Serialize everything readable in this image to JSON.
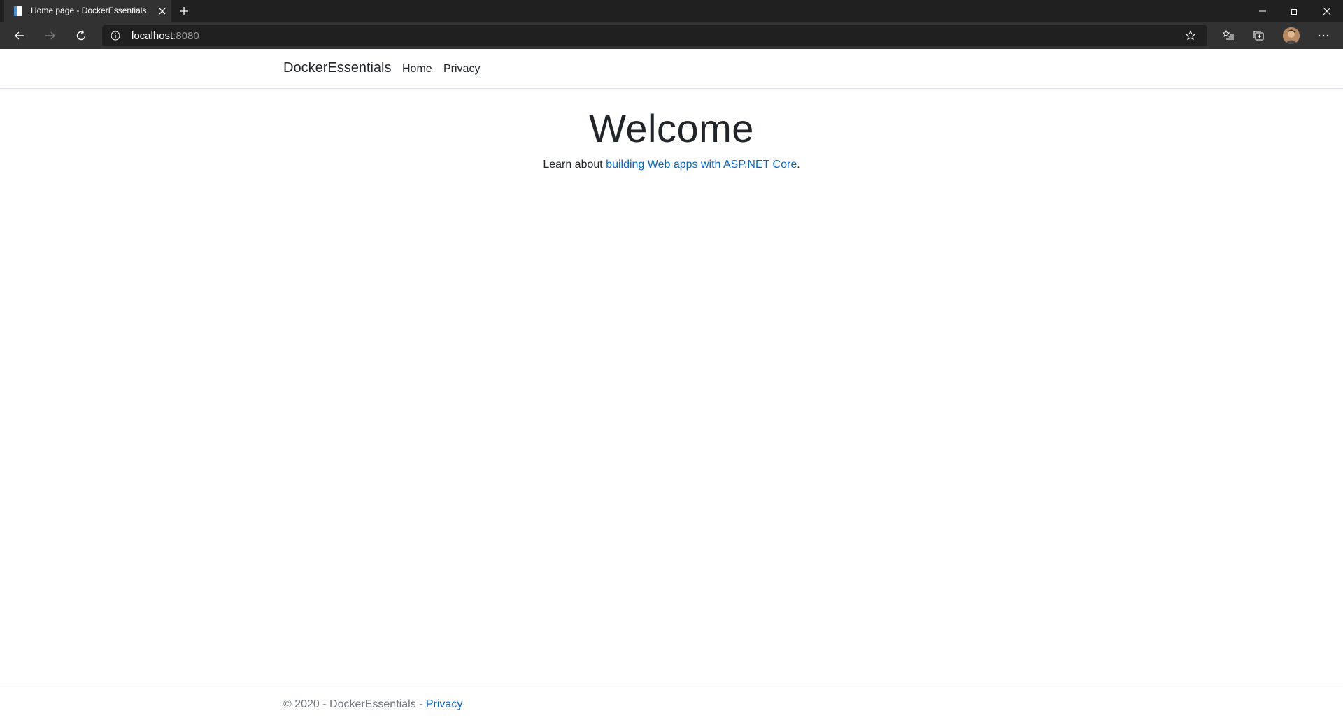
{
  "browser": {
    "tab_title": "Home page - DockerEssentials",
    "url_host": "localhost",
    "url_port": ":8080"
  },
  "navbar": {
    "brand": "DockerEssentials",
    "links": [
      {
        "label": "Home"
      },
      {
        "label": "Privacy"
      }
    ]
  },
  "main": {
    "heading": "Welcome",
    "lead_prefix": "Learn about ",
    "lead_link": "building Web apps with ASP.NET Core",
    "lead_suffix": "."
  },
  "footer": {
    "text": "© 2020 - DockerEssentials - ",
    "link": "Privacy"
  },
  "colors": {
    "link": "#0366d6",
    "chrome_dark": "#202020",
    "chrome_toolbar": "#323232"
  }
}
